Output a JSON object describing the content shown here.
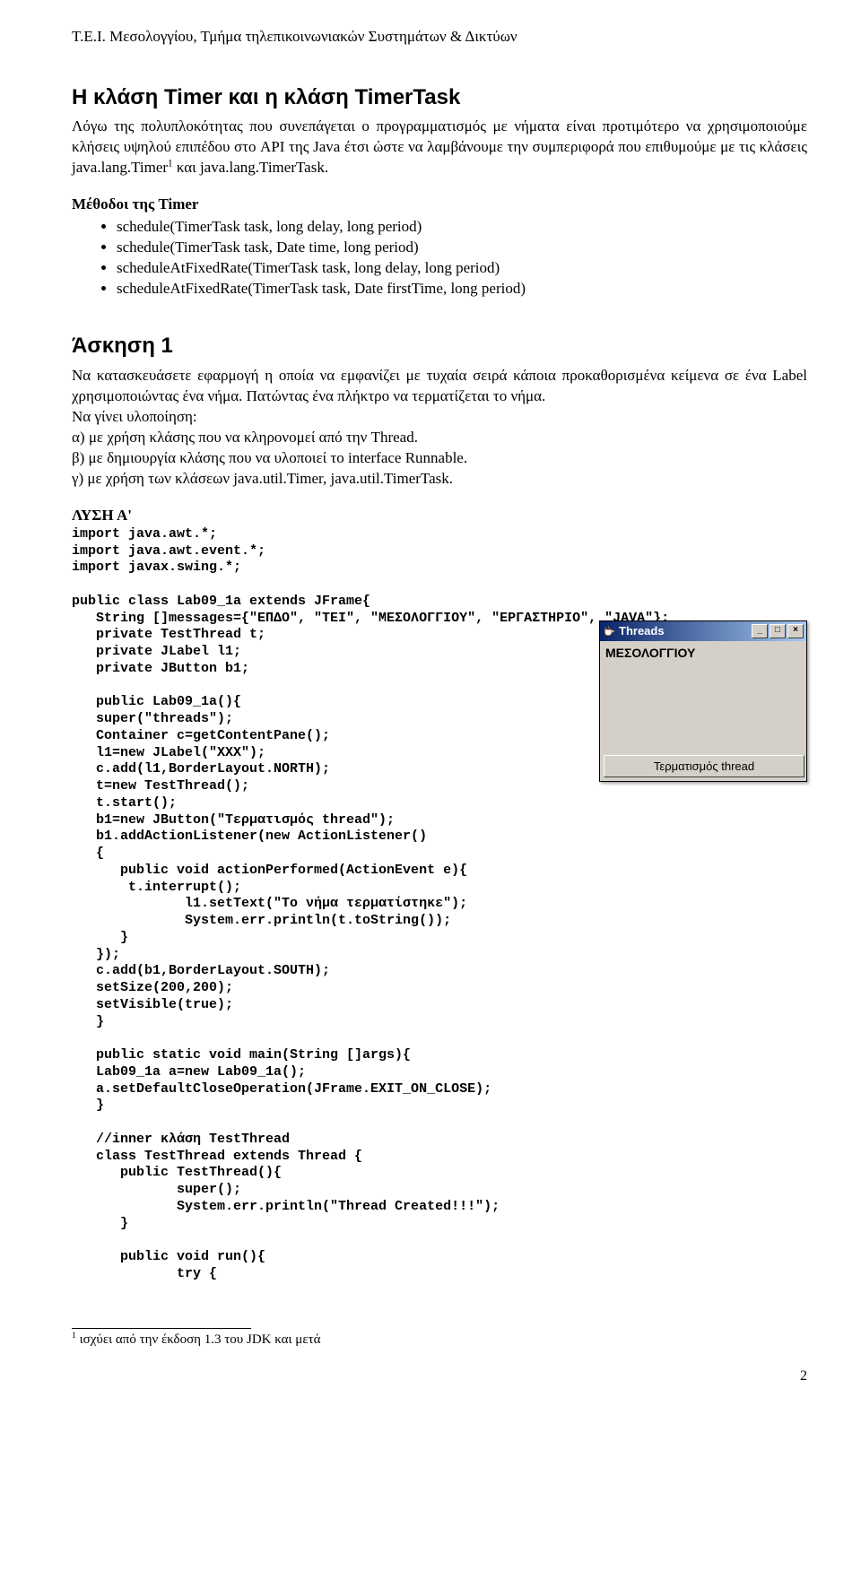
{
  "page": {
    "header": "Τ.Ε.Ι. Μεσολογγίου, Τμήμα τηλεπικοινωνιακών Συστημάτων & Δικτύων",
    "number": "2"
  },
  "heading_main": "Η κλάση Timer και η κλάση TimerTask",
  "intro_html": "Λόγω της πολυπλοκότητας που συνεπάγεται ο προγραμματισμός με νήματα είναι προτιμότερο να χρησιμοποιούμε κλήσεις υψηλού επιπέδου στο API της Java έτσι ώστε να λαμβάνουμε την συμπεριφορά που επιθυμούμε με τις κλάσεις java.lang.Timer<sup>1</sup> και java.lang.TimerTask.",
  "methods_heading": "Μέθοδοι της Timer",
  "methods": [
    "schedule(TimerTask task, long delay, long period)",
    "schedule(TimerTask task, Date time, long period)",
    "scheduleAtFixedRate(TimerTask task, long delay, long period)",
    "scheduleAtFixedRate(TimerTask task, Date firstTime, long period)"
  ],
  "exercise": {
    "heading": "Άσκηση 1",
    "para1": "Να κατασκευάσετε εφαρμογή η οποία να εμφανίζει με τυχαία σειρά κάποια προκαθορισμένα κείμενα σε ένα Label χρησιμοποιώντας ένα νήμα. Πατώντας ένα πλήκτρο να τερματίζεται το νήμα.",
    "impl_line": "Να γίνει υλοποίηση:",
    "a": "α) με χρήση κλάσης που να κληρονομεί από την Thread.",
    "b": "β) με δημιουργία κλάσης που να υλοποιεί το interface Runnable.",
    "c": "γ) με χρήση των κλάσεων java.util.Timer, java.util.TimerTask."
  },
  "solution_label": "ΛΥΣΗ Α'",
  "code_text": "import java.awt.*;\nimport java.awt.event.*;\nimport javax.swing.*;\n\npublic class Lab09_1a extends JFrame{\n   String []messages={\"ΕΠΔΟ\", \"TEI\", \"ΜΕΣΟΛΟΓΓΙΟΥ\", \"ΕΡΓΑΣΤΗΡΙΟ\", \"JAVA\"};\n   private TestThread t;\n   private JLabel l1;\n   private JButton b1;\n\n   public Lab09_1a(){\n   super(\"threads\");\n   Container c=getContentPane();\n   l1=new JLabel(\"XXX\");\n   c.add(l1,BorderLayout.NORTH);\n   t=new TestThread();\n   t.start();\n   b1=new JButton(\"Τερματισμός thread\");\n   b1.addActionListener(new ActionListener()\n   {\n      public void actionPerformed(ActionEvent e){\n       t.interrupt();\n              l1.setText(\"Το νήμα τερματίστηκε\");\n              System.err.println(t.toString());\n      }\n   });\n   c.add(b1,BorderLayout.SOUTH);\n   setSize(200,200);\n   setVisible(true);\n   }\n\n   public static void main(String []args){\n   Lab09_1a a=new Lab09_1a();\n   a.setDefaultCloseOperation(JFrame.EXIT_ON_CLOSE);\n   }\n\n   //inner κλάση TestThread\n   class TestThread extends Thread {\n      public TestThread(){\n             super();\n             System.err.println(\"Thread Created!!!\");\n      }\n\n      public void run(){\n             try {",
  "footnote": "ισχύει από την έκδοση 1.3 του JDK και μετά",
  "footnote_marker": "1",
  "window": {
    "title": "Threads",
    "body_text": "ΜΕΣΟΛΟΓΓΙΟΥ",
    "button": "Τερματισμός thread",
    "min": "_",
    "max": "□",
    "close": "×"
  }
}
